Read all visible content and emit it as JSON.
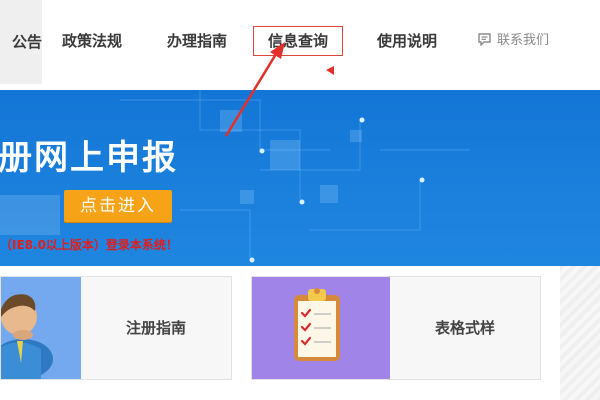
{
  "nav": {
    "items": [
      {
        "label": "公告"
      },
      {
        "label": "政策法规"
      },
      {
        "label": "办理指南"
      },
      {
        "label": "信息查询"
      },
      {
        "label": "使用说明"
      }
    ],
    "contact_label": "联系我们"
  },
  "banner": {
    "title": "册网上申报",
    "button_label": "点击进入",
    "note": "（IE8.0以上版本）登录本系统！"
  },
  "cards": [
    {
      "label": "注册指南",
      "icon": "user-avatar-icon"
    },
    {
      "label": "表格式样",
      "icon": "clipboard-checklist-icon"
    }
  ],
  "colors": {
    "banner_bg": "#1b7fdc",
    "button_bg": "#f7a318",
    "highlight_border": "#e0463c",
    "note_text": "#e31c1c",
    "card1_icon_bg": "#74a9ef",
    "card2_icon_bg": "#a084e8"
  }
}
